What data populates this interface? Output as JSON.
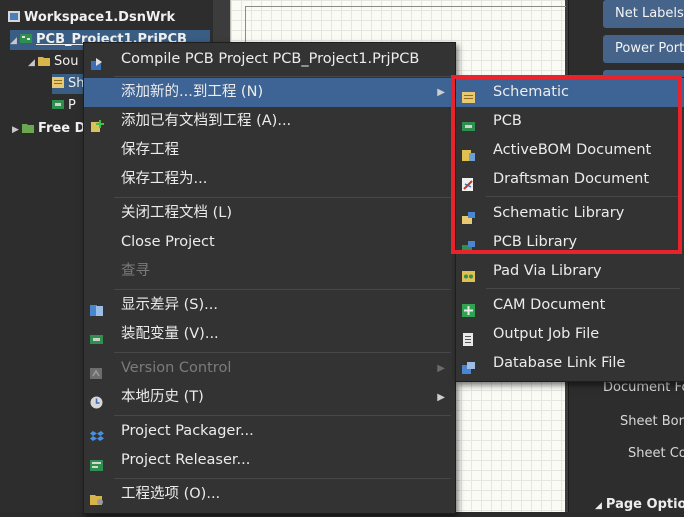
{
  "tree": {
    "workspace": "Workspace1.DsnWrk",
    "project": "PCB_Project1.PrjPCB",
    "source_folder": "Sou",
    "item_sch": "Sh",
    "item_pcb": "P",
    "free_docs": "Free D"
  },
  "properties": {
    "net_labels": "Net Labels",
    "power_ports": "Power Ports",
    "document_font": "Document Fo",
    "sheet_border": "Sheet Bord",
    "sheet_color": "Sheet Col",
    "page_options": "Page Option"
  },
  "context_menu": {
    "compile": "Compile PCB Project PCB_Project1.PrjPCB",
    "add_new": "添加新的...到工程 (N)",
    "add_existing": "添加已有文档到工程 (A)...",
    "save_project": "保存工程",
    "save_project_as": "保存工程为...",
    "close_project_docs": "关闭工程文档 (L)",
    "close_project": "Close Project",
    "explore": "查寻",
    "show_differences": "显示差异 (S)...",
    "variants": "装配变量 (V)...",
    "version_control": "Version Control",
    "local_history": "本地历史 (T)",
    "project_packager": "Project Packager...",
    "project_releaser": "Project Releaser...",
    "project_options": "工程选项 (O)..."
  },
  "submenu": {
    "schematic": "Schematic",
    "pcb": "PCB",
    "activebom": "ActiveBOM Document",
    "draftsman": "Draftsman Document",
    "schematic_library": "Schematic Library",
    "pcb_library": "PCB Library",
    "pad_via_library": "Pad Via Library",
    "cam_document": "CAM Document",
    "output_job": "Output Job File",
    "database_link": "Database Link File"
  },
  "colors": {
    "highlight": "#3d6495",
    "annotation_box": "#e8232b",
    "menu_bg": "#333333"
  }
}
